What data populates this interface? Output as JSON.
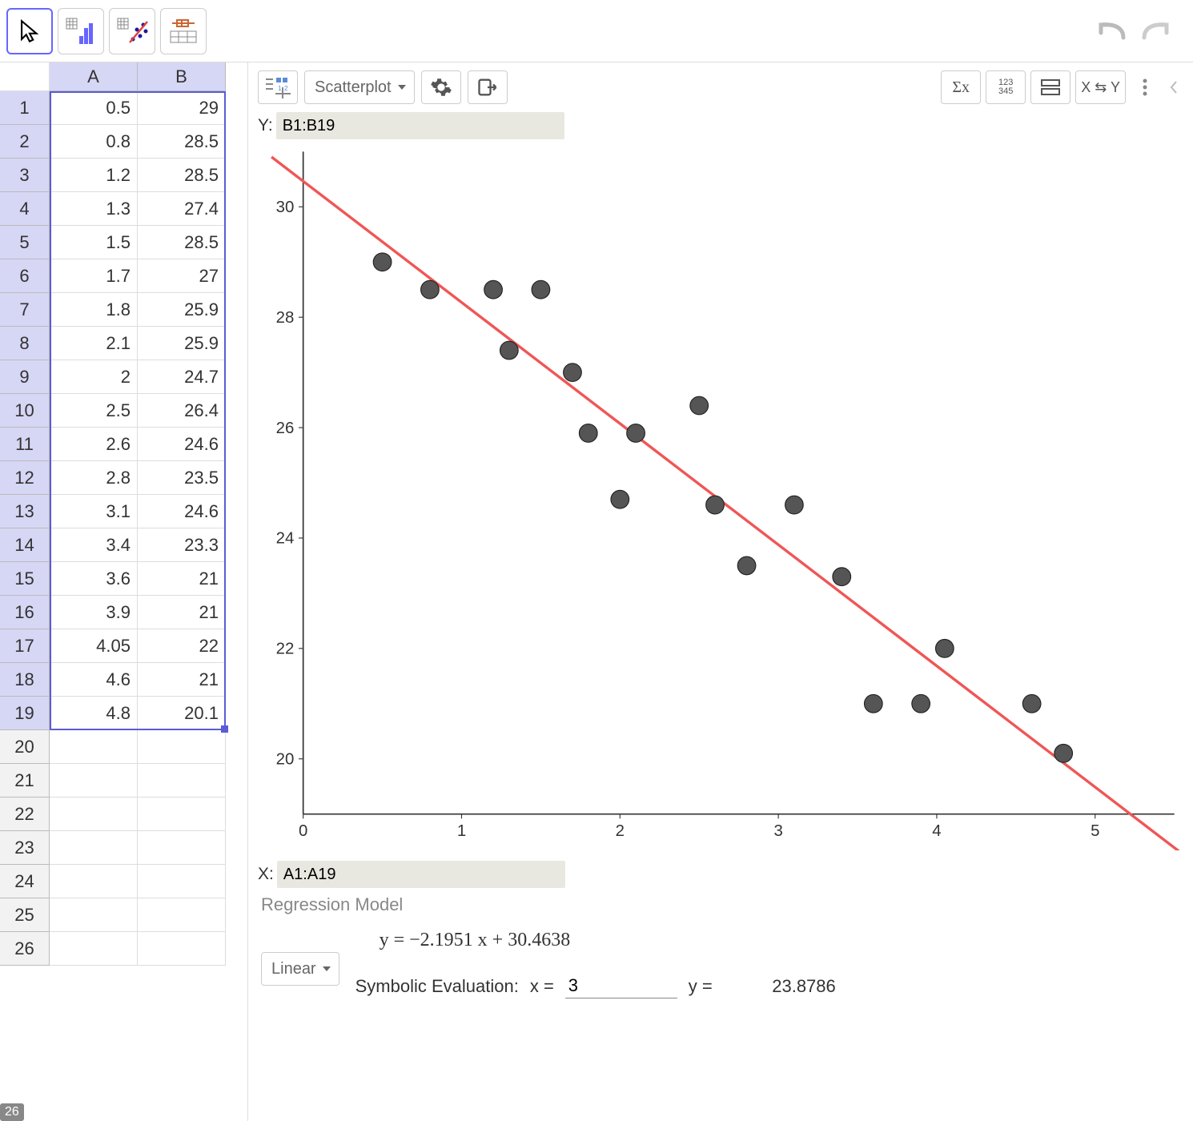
{
  "toolbar": {
    "tools": [
      "pointer",
      "one-var-analysis",
      "two-var-regression",
      "multi-var-analysis"
    ],
    "selected": 0
  },
  "spreadsheet": {
    "columns": [
      "A",
      "B"
    ],
    "max_row": 26,
    "footer_row": "26",
    "selection": {
      "rows_from": 1,
      "rows_to": 19,
      "cols": [
        "A",
        "B"
      ]
    },
    "rows": [
      {
        "n": 1,
        "A": "0.5",
        "B": "29"
      },
      {
        "n": 2,
        "A": "0.8",
        "B": "28.5"
      },
      {
        "n": 3,
        "A": "1.2",
        "B": "28.5"
      },
      {
        "n": 4,
        "A": "1.3",
        "B": "27.4"
      },
      {
        "n": 5,
        "A": "1.5",
        "B": "28.5"
      },
      {
        "n": 6,
        "A": "1.7",
        "B": "27"
      },
      {
        "n": 7,
        "A": "1.8",
        "B": "25.9"
      },
      {
        "n": 8,
        "A": "2.1",
        "B": "25.9"
      },
      {
        "n": 9,
        "A": "2",
        "B": "24.7"
      },
      {
        "n": 10,
        "A": "2.5",
        "B": "26.4"
      },
      {
        "n": 11,
        "A": "2.6",
        "B": "24.6"
      },
      {
        "n": 12,
        "A": "2.8",
        "B": "23.5"
      },
      {
        "n": 13,
        "A": "3.1",
        "B": "24.6"
      },
      {
        "n": 14,
        "A": "3.4",
        "B": "23.3"
      },
      {
        "n": 15,
        "A": "3.6",
        "B": "21"
      },
      {
        "n": 16,
        "A": "3.9",
        "B": "21"
      },
      {
        "n": 17,
        "A": "4.05",
        "B": "22"
      },
      {
        "n": 18,
        "A": "4.6",
        "B": "21"
      },
      {
        "n": 19,
        "A": "4.8",
        "B": "20.1"
      }
    ]
  },
  "analysis": {
    "plot_type_label": "Scatterplot",
    "y_label": "Y:",
    "y_range": "B1:B19",
    "x_label": "X:",
    "x_range": "A1:A19",
    "buttons": {
      "sigma": "Σx",
      "grid": "123\n345",
      "layout": "⊟",
      "swap": "X ⇆ Y"
    }
  },
  "chart_data": {
    "type": "scatter",
    "x": [
      0.5,
      0.8,
      1.2,
      1.3,
      1.5,
      1.7,
      1.8,
      2.1,
      2.0,
      2.5,
      2.6,
      2.8,
      3.1,
      3.4,
      3.6,
      3.9,
      4.05,
      4.6,
      4.8
    ],
    "y": [
      29,
      28.5,
      28.5,
      27.4,
      28.5,
      27,
      25.9,
      25.9,
      24.7,
      26.4,
      24.6,
      23.5,
      24.6,
      23.3,
      21,
      21,
      22,
      21,
      20.1
    ],
    "xlim": [
      0,
      5.5
    ],
    "ylim": [
      19,
      31
    ],
    "xticks": [
      0,
      1,
      2,
      3,
      4,
      5
    ],
    "yticks": [
      20,
      22,
      24,
      26,
      28,
      30
    ],
    "regression": {
      "slope": -2.1951,
      "intercept": 30.4638,
      "line_x": [
        -0.2,
        5.6
      ]
    }
  },
  "regression": {
    "section_title": "Regression Model",
    "model_label": "Linear",
    "equation": "y = −2.1951 x + 30.4638",
    "sym_eval_label": "Symbolic Evaluation:",
    "x_label": "x =",
    "x_value": "3",
    "y_label": "y =",
    "y_value": "23.8786"
  }
}
